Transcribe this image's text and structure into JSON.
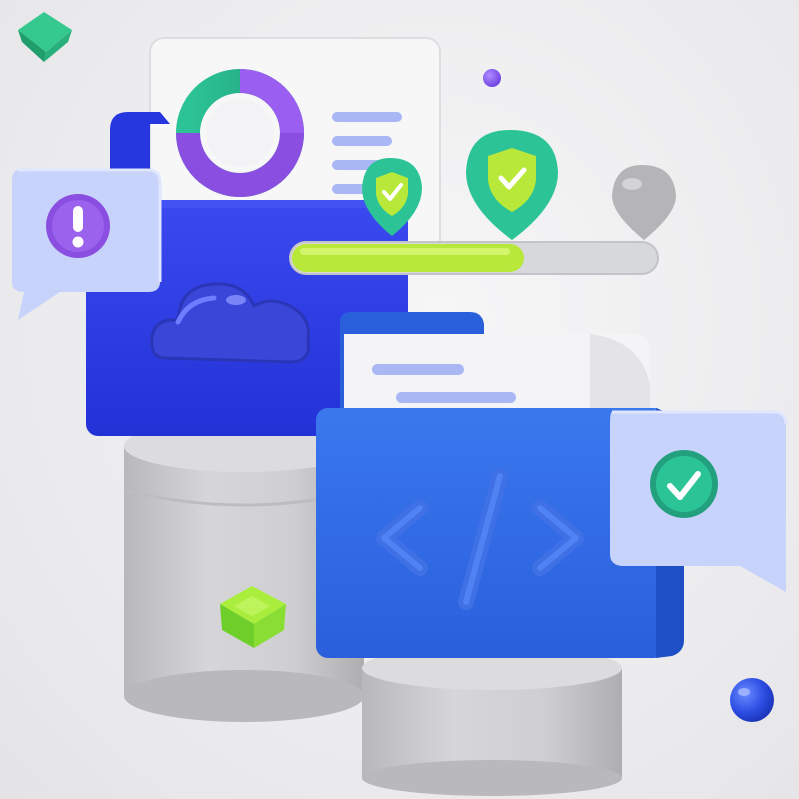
{
  "scene": {
    "background": "#ececee",
    "palette": {
      "folder_blue_dark": "#2f3fe8",
      "folder_blue": "#2f6ae6",
      "purple": "#8a4fe0",
      "teal": "#2cc497",
      "lime": "#b7e83a",
      "pedestal_gray": "#c9c9cb",
      "bubble_light": "#c7d3fb"
    },
    "icons": [
      "cloud-icon",
      "code-brackets-icon",
      "alert-exclamation-icon",
      "check-icon",
      "shield-check-icon",
      "donut-chart-icon",
      "map-pin-icon"
    ]
  }
}
